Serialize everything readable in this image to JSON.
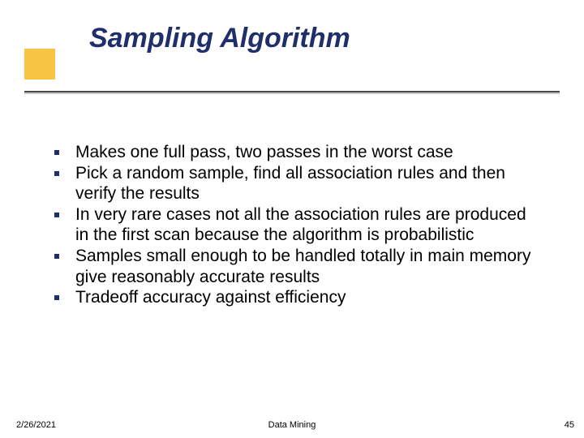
{
  "title": "Sampling Algorithm",
  "bullets": [
    "Makes one full pass, two passes in the worst case",
    "Pick a random sample, find all association rules and then verify the results",
    "In very rare cases not all the association rules are produced in the first scan because the algorithm is probabilistic",
    "Samples small enough to be handled totally in main memory give reasonably accurate results",
    "Tradeoff  accuracy against efficiency"
  ],
  "footer": {
    "date": "2/26/2021",
    "center": "Data Mining",
    "page": "45"
  }
}
